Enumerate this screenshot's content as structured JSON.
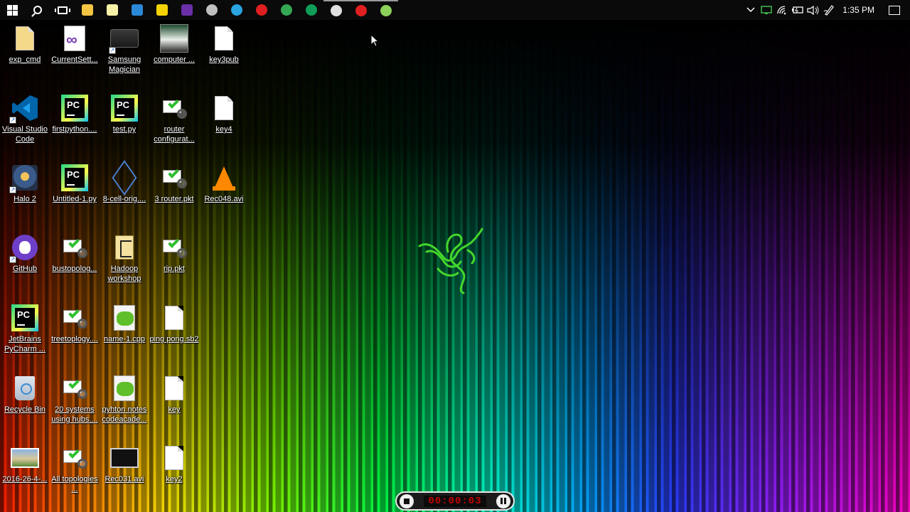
{
  "taskbar": {
    "pinned_apps": [
      {
        "name": "file-explorer",
        "color": "#f4c542"
      },
      {
        "name": "sticky-notes",
        "color": "#f7f1a8"
      },
      {
        "name": "remote-desktop",
        "color": "#2b89d9"
      },
      {
        "name": "sticky-notes-yellow",
        "color": "#f5d300"
      },
      {
        "name": "visual-studio",
        "color": "#6b2fa8"
      },
      {
        "name": "network-app",
        "color": "#c0c0c0"
      },
      {
        "name": "telegram",
        "color": "#2aa4e0"
      },
      {
        "name": "opera",
        "color": "#e02020"
      },
      {
        "name": "chrome",
        "color": "#34a853"
      },
      {
        "name": "hangouts",
        "color": "#0f9d58"
      },
      {
        "name": "steam",
        "color": "#e0e0e0"
      },
      {
        "name": "opera-gx",
        "color": "#e02020"
      },
      {
        "name": "recorder-app",
        "color": "#8bd15a"
      }
    ],
    "clock": "1:35 PM"
  },
  "desktop_icons": [
    {
      "label": "exp_cmd",
      "type": "vscode-folder"
    },
    {
      "label": "CurrentSett...",
      "type": "vs-settings"
    },
    {
      "label": "Samsung Magician",
      "type": "drive"
    },
    {
      "label": "computer ...",
      "type": "photo"
    },
    {
      "label": "key3pub",
      "type": "doc"
    },
    {
      "label": "Visual Studio Code",
      "type": "vscode"
    },
    {
      "label": "firstpython....",
      "type": "pycharm"
    },
    {
      "label": "test.py",
      "type": "pycharm"
    },
    {
      "label": "router configurat...",
      "type": "packet"
    },
    {
      "label": "key4",
      "type": "doc"
    },
    {
      "label": "Halo 2",
      "type": "halo"
    },
    {
      "label": "Untitled-1.py",
      "type": "pycharm"
    },
    {
      "label": "8-cell-orig....",
      "type": "cube"
    },
    {
      "label": "3 router.pkt",
      "type": "packet"
    },
    {
      "label": "Rec048.avi",
      "type": "vlc"
    },
    {
      "label": "GitHub",
      "type": "github"
    },
    {
      "label": "bustopolog...",
      "type": "packet"
    },
    {
      "label": "Hadoop workshop",
      "type": "hadoop"
    },
    {
      "label": "rip.pkt",
      "type": "packet"
    },
    {
      "label": "JetBrains PyCharm ...",
      "type": "pycharm"
    },
    {
      "label": "treetoplogy....",
      "type": "packet"
    },
    {
      "label": "name-1.cpp",
      "type": "cpp"
    },
    {
      "label": "ping pong.sb2",
      "type": "doc"
    },
    {
      "label": "Recycle Bin",
      "type": "recycle"
    },
    {
      "label": "20 systems using hubs....",
      "type": "packet"
    },
    {
      "label": "pyhton notes codeacade...",
      "type": "cpp"
    },
    {
      "label": "key",
      "type": "doc"
    },
    {
      "label": "2016-26-4-...",
      "type": "image"
    },
    {
      "label": "All topologies ...",
      "type": "packet"
    },
    {
      "label": "Rec031.avi",
      "type": "film"
    },
    {
      "label": "key2",
      "type": "doc"
    }
  ],
  "recorder": {
    "time": "00:00:03"
  },
  "wallpaper": {
    "logo_color": "#44d62c"
  }
}
